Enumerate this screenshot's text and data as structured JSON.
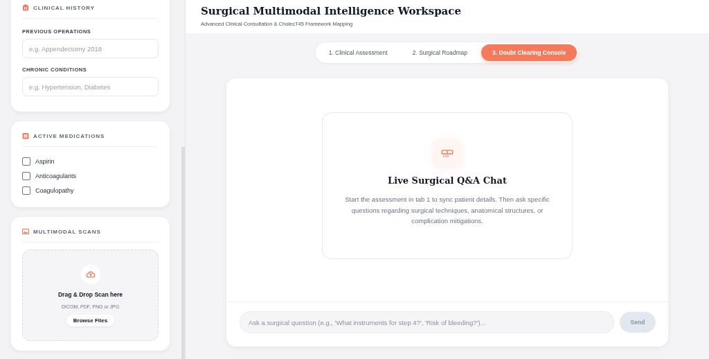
{
  "sidebar": {
    "clinical_history": {
      "title": "CLINICAL HISTORY",
      "fields": [
        {
          "label": "PREVIOUS OPERATIONS",
          "placeholder": "e.g. Appendectomy 2018"
        },
        {
          "label": "CHRONIC CONDITIONS",
          "placeholder": "e.g. Hypertension, Diabetes"
        }
      ]
    },
    "active_medications": {
      "title": "ACTIVE MEDICATIONS",
      "items": [
        {
          "label": "Aspirin",
          "checked": false
        },
        {
          "label": "Anticoagulants",
          "checked": false
        },
        {
          "label": "Coagulopathy",
          "checked": false
        }
      ]
    },
    "multimodal_scans": {
      "title": "MULTIMODAL SCANS",
      "dropzone": {
        "title": "Drag & Drop Scan here",
        "hint": "DICOM, PDF, PNG or JPG",
        "button": "Browse Files"
      }
    }
  },
  "header": {
    "title": "Surgical Multimodal Intelligence Workspace",
    "subtitle": "Advanced Clinical Consultation & CholecT45 Framework Mapping"
  },
  "tabs": [
    {
      "label": "1. Clinical Assessment",
      "selected": false
    },
    {
      "label": "2. Surgical Roadmap",
      "selected": false
    },
    {
      "label": "3. Doubt Clearing Console",
      "selected": true
    }
  ],
  "chat": {
    "empty_state": {
      "title": "Live Surgical Q&A Chat",
      "text": "Start the assessment in tab 1 to sync patient details. Then ask specific questions regarding surgical techniques, anatomical structures, or complication mitigations."
    },
    "input": {
      "placeholder": "Ask a surgical question (e.g., 'What instruments for step 4?', 'Risk of bleeding?')..."
    },
    "send": {
      "label": "Send",
      "disabled": true
    }
  }
}
